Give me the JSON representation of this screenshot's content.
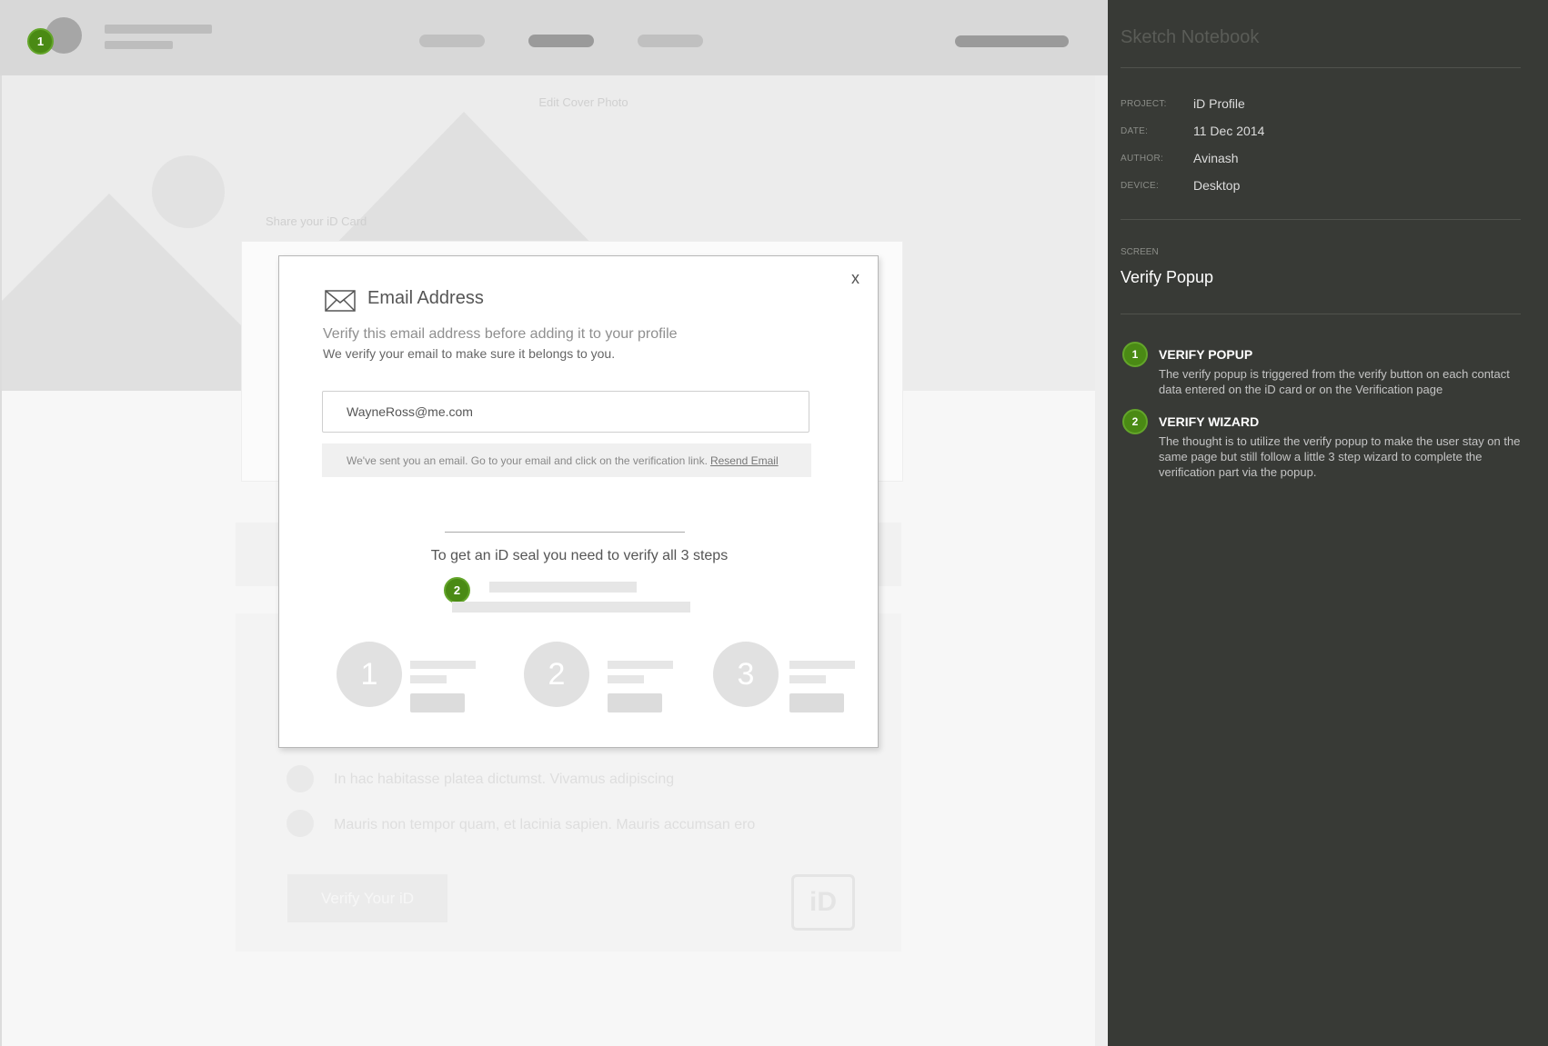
{
  "canvas": {
    "cover_label": "Edit Cover Photo",
    "share_label": "Share your iD Card",
    "list_items": [
      "In hac habitasse platea dictumst. Vivamus adipiscing",
      "Mauris non tempor quam, et lacinia sapien. Mauris accumsan ero"
    ],
    "verify_button": "Verify Your iD",
    "logo_text": "iD",
    "header_badge": "1"
  },
  "modal": {
    "close": "x",
    "title": "Email Address",
    "subtitle": "Verify this email address before adding it to your profile",
    "subtitle2": "We verify your email to make sure it belongs to you.",
    "email_value": "WayneRoss@me.com",
    "notice_text": "We've sent you an email. Go to your email and click on the verification link.",
    "resend_link": "Resend Email",
    "seal_text": "To get an iD seal you need to verify all 3 steps",
    "wizard_badge": "2",
    "steps": [
      "1",
      "2",
      "3"
    ]
  },
  "notebook": {
    "title": "Sketch Notebook",
    "meta": [
      {
        "key": "PROJECT:",
        "value": "iD Profile"
      },
      {
        "key": "DATE:",
        "value": "11 Dec 2014"
      },
      {
        "key": "AUTHOR:",
        "value": "Avinash"
      },
      {
        "key": "DEVICE:",
        "value": "Desktop"
      }
    ],
    "screen_label": "SCREEN",
    "screen_name": "Verify Popup",
    "notes": [
      {
        "number": "1",
        "title": "VERIFY POPUP",
        "body": "The verify popup is triggered from the verify button on each contact data entered on the iD card or on the Verification page"
      },
      {
        "number": "2",
        "title": "VERIFY WIZARD",
        "body": "The thought is to utilize the verify popup to make the user stay on the same page but still follow a little 3 step wizard to complete the verification part via the popup."
      }
    ]
  },
  "colors": {
    "accent_green": "#4a8a14",
    "panel_bg": "#383a36"
  }
}
